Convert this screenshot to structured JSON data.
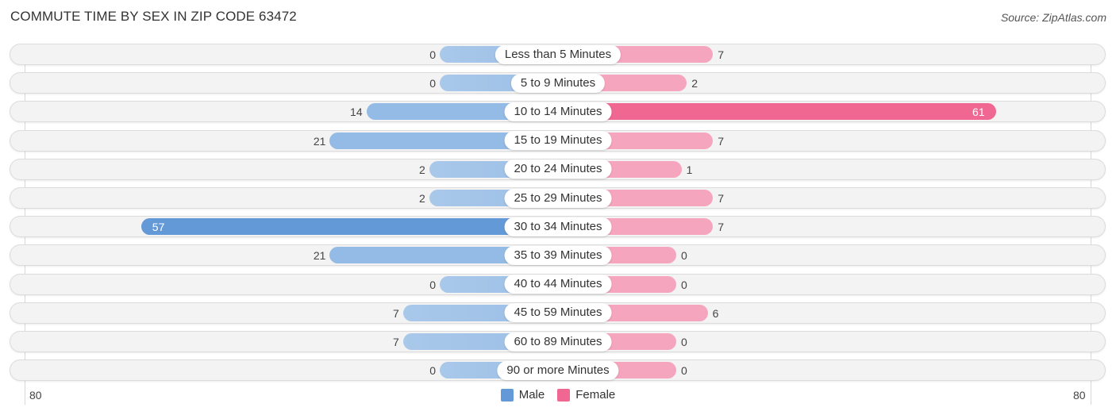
{
  "header": {
    "title": "COMMUTE TIME BY SEX IN ZIP CODE 63472",
    "source": "Source: ZipAtlas.com"
  },
  "colors": {
    "male_strong": "#6499d8",
    "male_light": "#a9c8ea",
    "female_strong": "#f06792",
    "female_light": "#f5a5bd"
  },
  "chart_data": {
    "type": "bar",
    "orientation": "horizontal-diverging",
    "title": "COMMUTE TIME BY SEX IN ZIP CODE 63472",
    "categories": [
      "Less than 5 Minutes",
      "5 to 9 Minutes",
      "10 to 14 Minutes",
      "15 to 19 Minutes",
      "20 to 24 Minutes",
      "25 to 29 Minutes",
      "30 to 34 Minutes",
      "35 to 39 Minutes",
      "40 to 44 Minutes",
      "45 to 59 Minutes",
      "60 to 89 Minutes",
      "90 or more Minutes"
    ],
    "series": [
      {
        "name": "Male",
        "values": [
          0,
          0,
          14,
          21,
          2,
          2,
          57,
          21,
          0,
          7,
          7,
          0
        ]
      },
      {
        "name": "Female",
        "values": [
          7,
          2,
          61,
          7,
          1,
          7,
          7,
          0,
          0,
          6,
          0,
          0
        ]
      }
    ],
    "axis": {
      "left_label": "80",
      "right_label": "80",
      "range": [
        80,
        80
      ]
    },
    "legend": {
      "position": "bottom-center",
      "entries": [
        "Male",
        "Female"
      ]
    },
    "grid": false
  }
}
